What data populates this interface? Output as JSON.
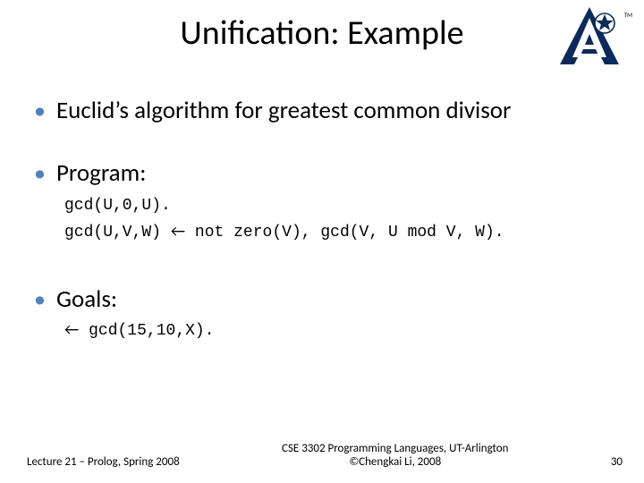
{
  "title": "Unification: Example",
  "logo": {
    "name": "uta-logo"
  },
  "bullets": {
    "b1": "Euclid’s algorithm for greatest common divisor",
    "b2": "Program:",
    "code1": "gcd(U,0,U).",
    "code2a": "gcd(U,V,W) ",
    "code2_arrow": "←",
    "code2b": " not zero(V), gcd(V, U mod V, W).",
    "b3": "Goals:",
    "goal_arrow": "←",
    "goal": " gcd(15,10,X)."
  },
  "footer": {
    "left": "Lecture 21 – Prolog, Spring 2008",
    "center1": "CSE 3302 Programming Languages, UT-Arlington",
    "center2": "©Chengkai Li, 2008",
    "page": "30"
  }
}
